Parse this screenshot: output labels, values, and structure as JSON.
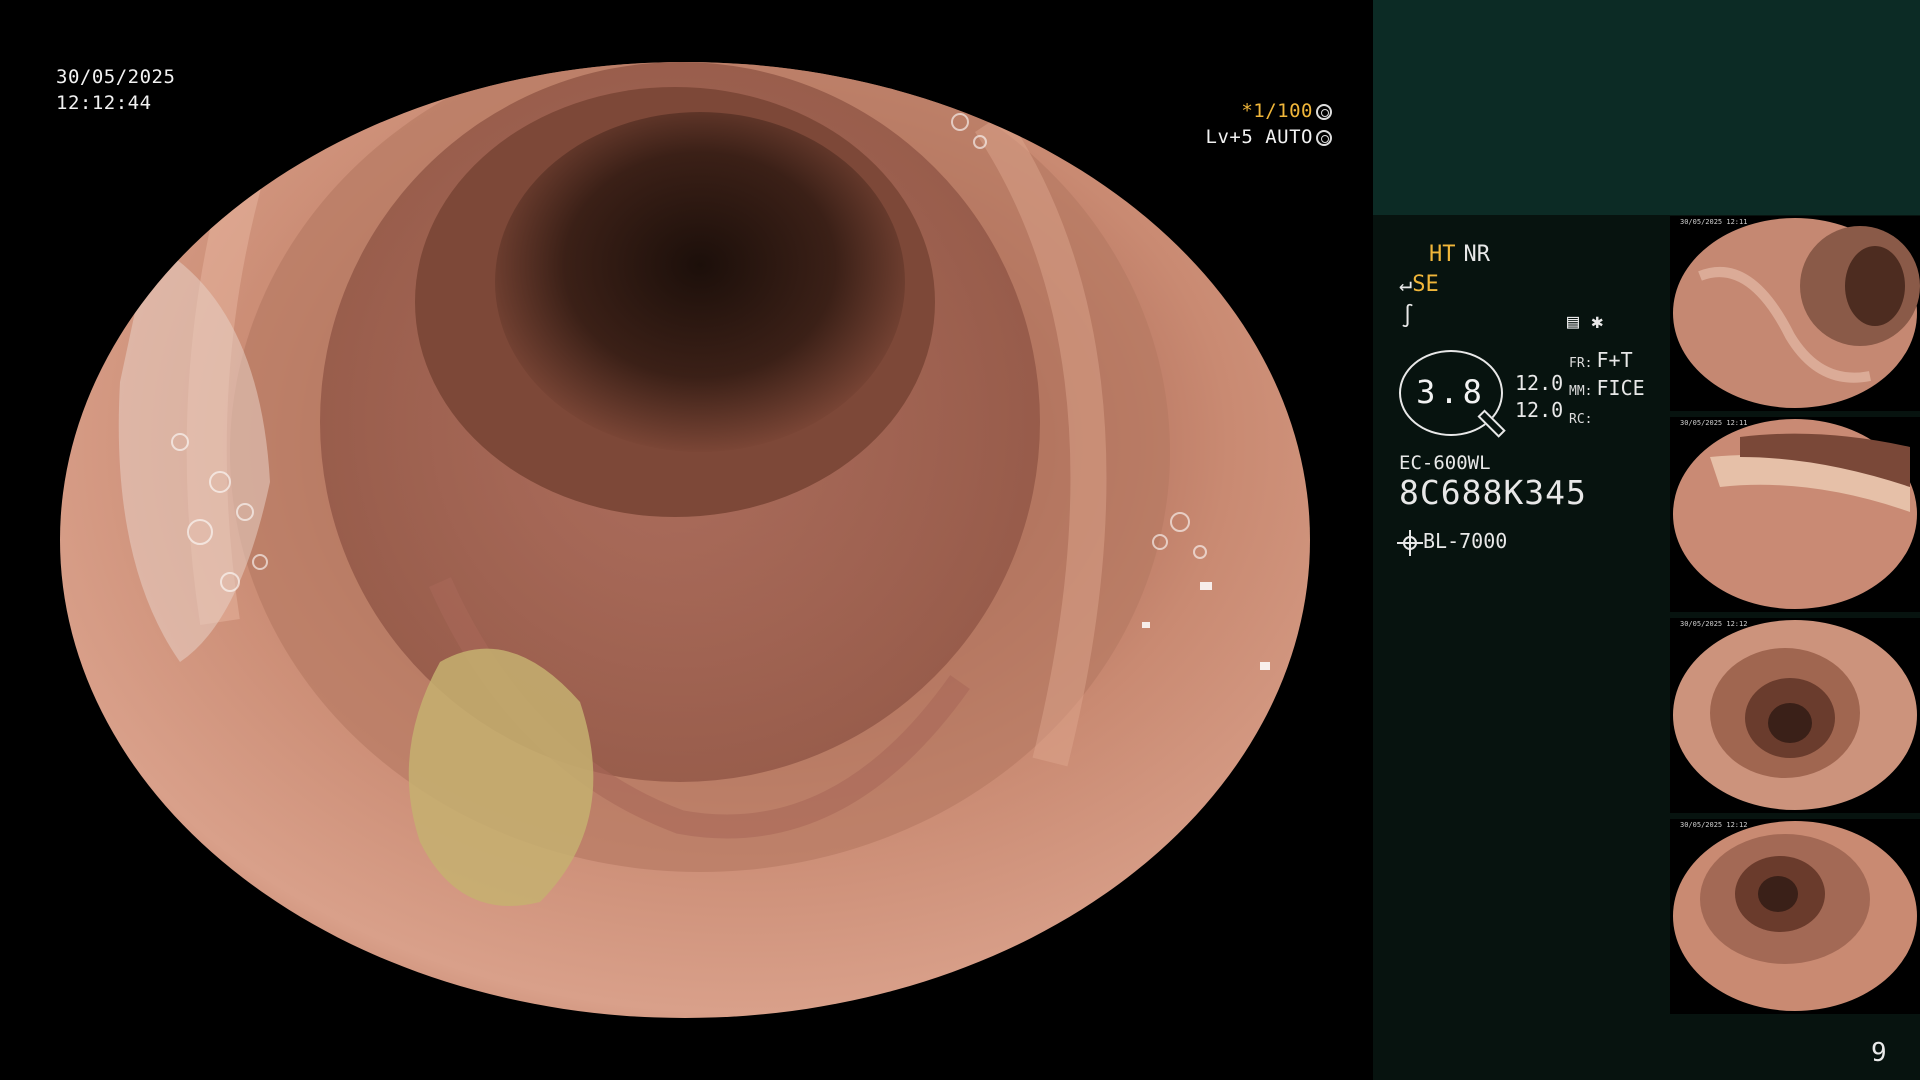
{
  "overlay": {
    "date": "30/05/2025",
    "time": "12:12:44",
    "shutter_prefix": "*",
    "shutter": "1/100",
    "level": "Lv+5",
    "exposure_mode": "AUTO"
  },
  "panel": {
    "ht_label": "HT",
    "nr_label": "NR",
    "se_label": "SE",
    "scope_value": "3.8",
    "value_1": "12.0",
    "value_2": "12.0",
    "fr_label": "FR:",
    "fr_value": "F+T",
    "mm_label": "MM:",
    "mm_value": "FICE",
    "rc_label": "RC:",
    "scope_model": "EC-600WL",
    "serial_number": "8C688K345",
    "light_source": "BL-7000",
    "page_number": "9"
  },
  "thumbnails": [
    {
      "caption": "30/05/2025 12:11"
    },
    {
      "caption": "30/05/2025 12:11"
    },
    {
      "caption": "30/05/2025 12:12"
    },
    {
      "caption": "30/05/2025 12:12"
    }
  ],
  "colors": {
    "panel_bg": "#07130f",
    "panel_top_bg": "#0c2b25",
    "amber": "#f0b63a",
    "mucosa": "#c98a72"
  }
}
